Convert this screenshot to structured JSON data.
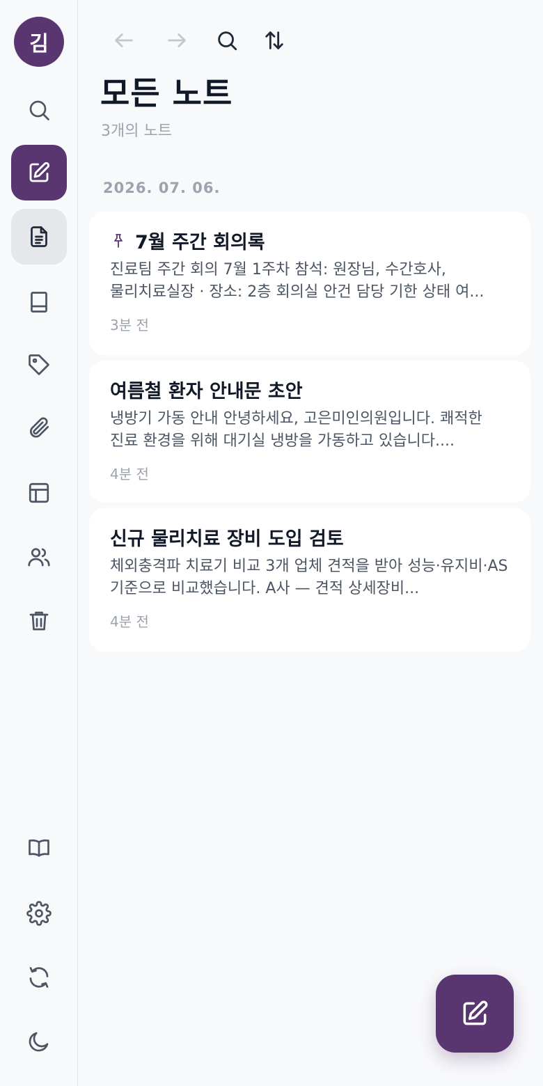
{
  "user": {
    "avatar_initial": "김"
  },
  "sidebar": {
    "items": [
      {
        "name": "search-icon"
      },
      {
        "name": "edit-icon",
        "state": "active"
      },
      {
        "name": "document-icon",
        "state": "selected"
      },
      {
        "name": "book-icon"
      },
      {
        "name": "tag-icon"
      },
      {
        "name": "paperclip-icon"
      },
      {
        "name": "table-icon"
      },
      {
        "name": "users-icon"
      },
      {
        "name": "trash-icon"
      }
    ],
    "bottom_items": [
      {
        "name": "open-book-icon"
      },
      {
        "name": "gear-icon"
      },
      {
        "name": "sync-icon"
      },
      {
        "name": "moon-icon"
      }
    ]
  },
  "toolbar": {
    "buttons": [
      "arrow-left-icon",
      "arrow-right-icon",
      "search-icon",
      "sort-icon"
    ]
  },
  "main": {
    "title": "모든 노트",
    "count_text": "3개의 노트",
    "date_header": "2026. 07. 06.",
    "notes": [
      {
        "pinned": true,
        "title": "7월 주간 회의록",
        "preview": "진료팀 주간 회의 7월 1주차 참석: 원장님, 수간호사, 물리치료실장 · 장소: 2층 회의실 안건 담당 기한 상태 여...",
        "time": "3분 전"
      },
      {
        "pinned": false,
        "title": "여름철 환자 안내문 초안",
        "preview": "냉방기 가동 안내 안녕하세요, 고은미인의원입니다. 쾌적한 진료 환경을 위해 대기실 냉방을 가동하고 있습니다....",
        "time": "4분 전"
      },
      {
        "pinned": false,
        "title": "신규 물리치료 장비 도입 검토",
        "preview": "체외충격파 치료기 비교 3개 업체 견적을 받아 성능·유지비·AS 기준으로 비교했습니다. A사 — 견적 상세장비...",
        "time": "4분 전"
      }
    ]
  },
  "colors": {
    "accent": "#5a3670",
    "background": "#f8f9fb",
    "card": "#ffffff",
    "muted_text": "#9ca3af"
  }
}
